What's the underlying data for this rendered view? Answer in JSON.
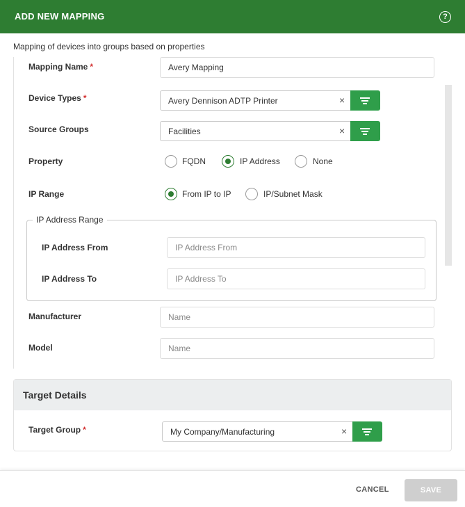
{
  "header": {
    "title": "ADD NEW MAPPING",
    "help_icon": "help-circle-icon",
    "background": "#2e7d32"
  },
  "subtitle": "Mapping of devices into groups based on properties",
  "form": {
    "mapping_name": {
      "label": "Mapping Name",
      "required": "*",
      "value": "Avery Mapping"
    },
    "device_types": {
      "label": "Device Types",
      "required": "*",
      "value": "Avery Dennison ADTP Printer",
      "clear": "×"
    },
    "source_groups": {
      "label": "Source Groups",
      "value": "Facilities",
      "clear": "×"
    },
    "property": {
      "label": "Property",
      "options": [
        "FQDN",
        "IP Address",
        "None"
      ],
      "selected": "IP Address"
    },
    "ip_range": {
      "label": "IP Range",
      "options": [
        "From IP to IP",
        "IP/Subnet Mask"
      ],
      "selected": "From IP to IP"
    },
    "ip_address_range": {
      "legend": "IP Address Range",
      "from": {
        "label": "IP Address From",
        "placeholder": "IP Address From"
      },
      "to": {
        "label": "IP Address To",
        "placeholder": "IP Address To"
      }
    },
    "manufacturer": {
      "label": "Manufacturer",
      "placeholder": "Name"
    },
    "model": {
      "label": "Model",
      "placeholder": "Name"
    }
  },
  "target": {
    "section_title": "Target Details",
    "target_group": {
      "label": "Target Group",
      "required": "*",
      "value": "My Company/Manufacturing",
      "clear": "×"
    }
  },
  "footer": {
    "cancel_label": "CANCEL",
    "save_label": "SAVE"
  },
  "colors": {
    "primary": "#2e7d32",
    "filter_button": "#2f9e4a",
    "required": "#d32f2f",
    "disabled": "#cfcfcf"
  }
}
